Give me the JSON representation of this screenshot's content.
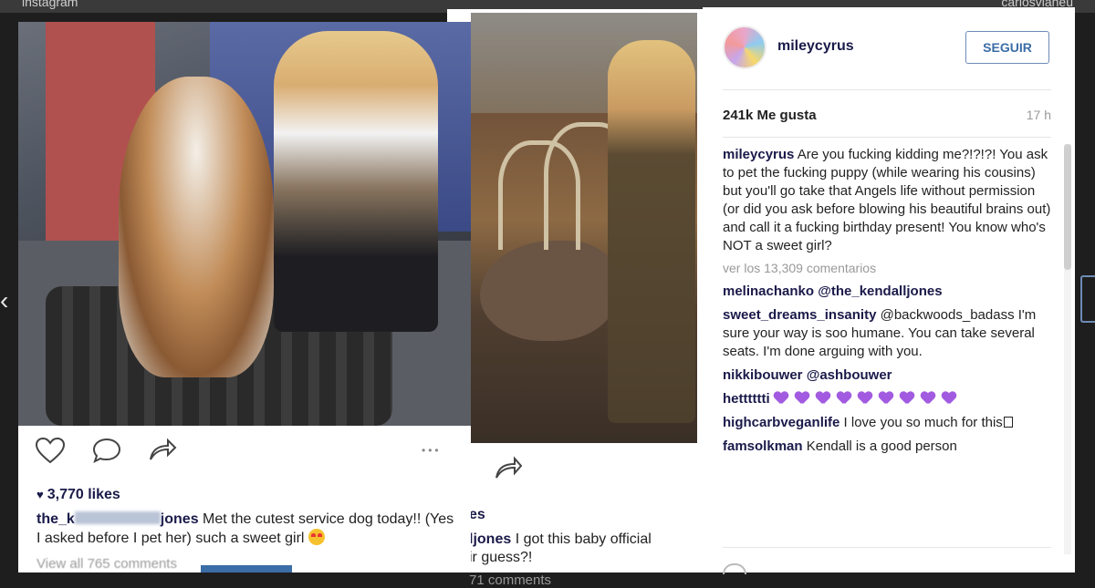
{
  "background": {
    "left_user": "instagram",
    "right_user": "carlosvianeu"
  },
  "post_left": {
    "likes": "3,770 likes",
    "caption_user_start": "the_k",
    "caption_user_end": "jones",
    "caption_text": "Met the cutest service dog today!! (Yes I asked before I pet her) such a sweet girl",
    "view_all": "View all 765 comments",
    "more": "•••"
  },
  "post_middle": {
    "likes_snippet": "es",
    "caption_user": "ljones",
    "caption_text": "I got this baby official",
    "caption_text_2": "ir guess?!",
    "comments_snippet": "71 comments"
  },
  "panel": {
    "username": "mileycyrus",
    "follow_label": "SEGUIR",
    "likes": "241k Me gusta",
    "time": "17 h",
    "view_more": "ver los 13,309 comentarios",
    "comments": [
      {
        "user": "mileycyrus",
        "text": "Are you fucking kidding me?!?!?! You ask to pet the fucking puppy (while wearing his cousins) but you'll go take that Angels life without permission (or did you ask before blowing his beautiful brains out) and call it a fucking birthday present! You know who's NOT a sweet girl?"
      },
      {
        "user": "melinachanko",
        "text": "@the_kendalljones"
      },
      {
        "user": "sweet_dreams_insanity",
        "text": "@backwoods_badass I'm sure your way is soo humane. You can take several seats. I'm done arguing with you."
      },
      {
        "user": "nikkibouwer",
        "text": "@ashbouwer"
      },
      {
        "user": "hetttttti",
        "text": "",
        "hearts": 9
      },
      {
        "user": "highcarbveganlife",
        "text": "I love you so much for this"
      },
      {
        "user": "famsolkman",
        "text": "Kendall is a good person"
      }
    ]
  },
  "colors": {
    "username_blue": "#1a1a4a",
    "follow_blue": "#3b6da6",
    "heart_purple": "#a25be0"
  }
}
